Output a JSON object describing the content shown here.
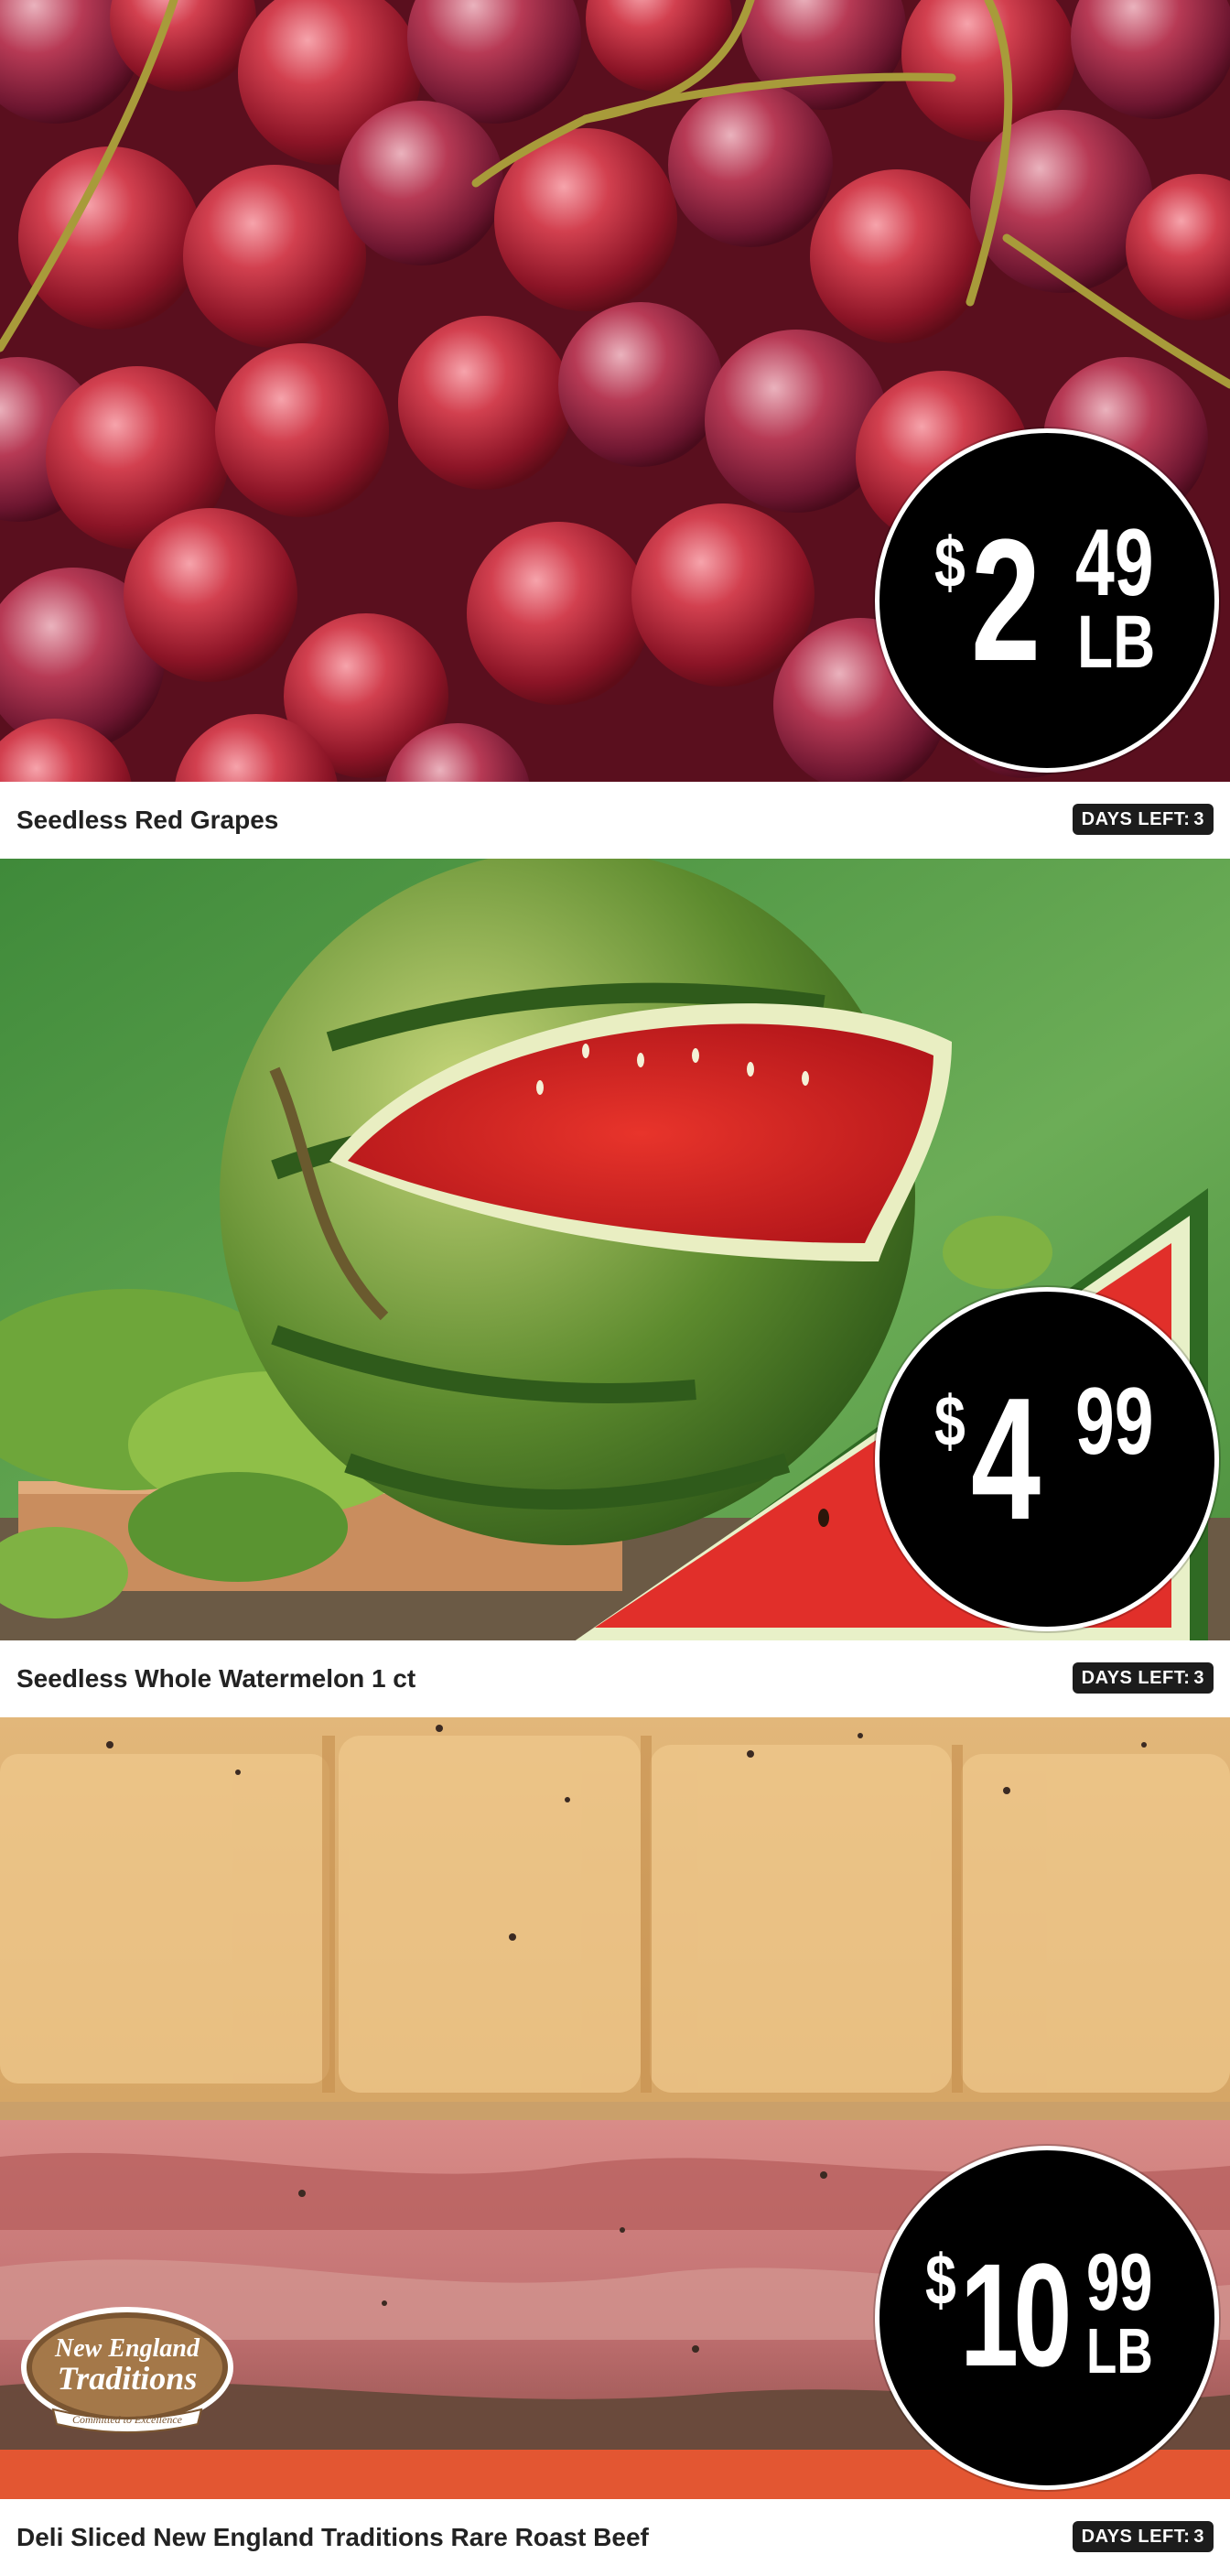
{
  "products": [
    {
      "title": "Seedless Red Grapes",
      "price": {
        "currency": "$",
        "dollars": "2",
        "cents": "49",
        "unit": "LB"
      },
      "days_left_label": "DAYS LEFT:",
      "days_left": "3",
      "image": "red-grapes-photo"
    },
    {
      "title": "Seedless Whole Watermelon 1 ct",
      "price": {
        "currency": "$",
        "dollars": "4",
        "cents": "99",
        "unit": ""
      },
      "days_left_label": "DAYS LEFT:",
      "days_left": "3",
      "image": "watermelon-photo"
    },
    {
      "title": "Deli Sliced New England Traditions Rare Roast Beef",
      "price": {
        "currency": "$",
        "dollars": "10",
        "cents": "99",
        "unit": "LB"
      },
      "days_left_label": "DAYS LEFT:",
      "days_left": "3",
      "image": "roast-beef-sandwich-photo",
      "brand_logo": {
        "line1": "New England",
        "line2": "Traditions",
        "tagline": "Committed to Excellence"
      }
    }
  ],
  "colors": {
    "badge_bg": "#000000",
    "badge_text": "#ffffff",
    "days_badge_bg": "#1c1c1c",
    "title_text": "#222222"
  }
}
